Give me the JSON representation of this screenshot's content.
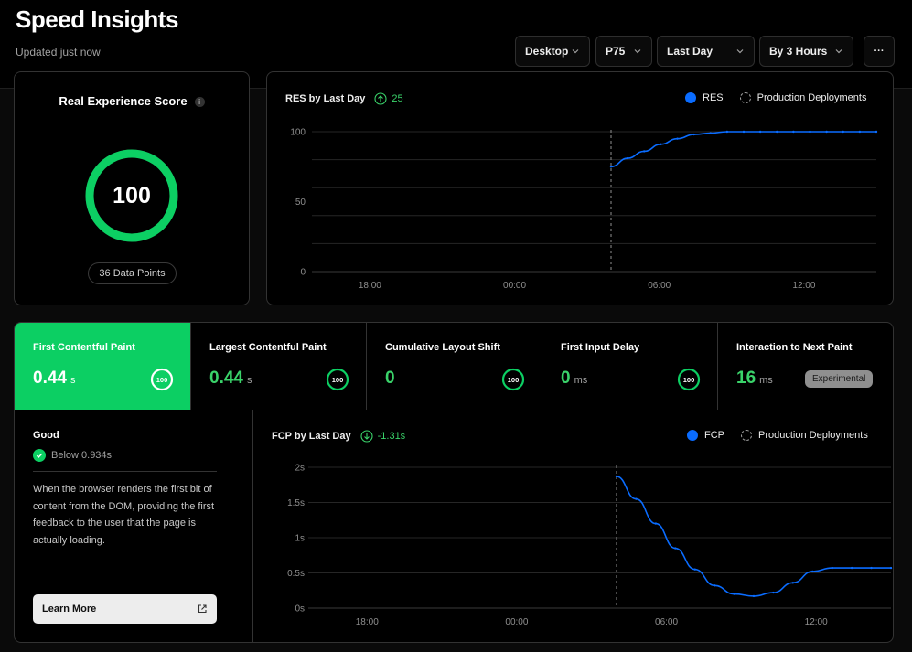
{
  "header": {
    "title": "Speed Insights",
    "subtitle": "Updated just now",
    "filters": {
      "device": "Desktop",
      "percentile": "P75",
      "range": "Last Day",
      "granularity": "By 3 Hours"
    },
    "more_label": "···"
  },
  "score_card": {
    "title": "Real Experience Score",
    "info_icon": "i",
    "value": "100",
    "score_fraction": 1.0,
    "data_points": "36 Data Points",
    "color": "#0ccf63"
  },
  "res_chart": {
    "title": "RES by Last Day",
    "delta": "25",
    "legend_series": "RES",
    "legend_deploy": "Production Deployments",
    "chart_data": {
      "type": "line",
      "title": "RES by Last Day",
      "y_ticks": [
        "100",
        "50",
        "0"
      ],
      "x_ticks": [
        "18:00",
        "00:00",
        "06:00",
        "12:00"
      ],
      "ylim": [
        0,
        100
      ],
      "series": [
        {
          "name": "RES",
          "color": "#0a6cff",
          "values": [
            75,
            81,
            86,
            91,
            95,
            98,
            99,
            100,
            100,
            100,
            100,
            100,
            100,
            100,
            100,
            100,
            100
          ]
        }
      ],
      "deployment_marker": "04:00",
      "x_start": "04:00",
      "x_end": "15:00",
      "grid": true
    }
  },
  "metrics": [
    {
      "name": "First Contentful Paint",
      "value": "0.44",
      "unit": "s",
      "score": "100",
      "active": true
    },
    {
      "name": "Largest Contentful Paint",
      "value": "0.44",
      "unit": "s",
      "score": "100",
      "active": false
    },
    {
      "name": "Cumulative Layout Shift",
      "value": "0",
      "unit": "",
      "score": "100",
      "active": false
    },
    {
      "name": "First Input Delay",
      "value": "0",
      "unit": "ms",
      "score": "100",
      "active": false
    },
    {
      "name": "Interaction to Next Paint",
      "value": "16",
      "unit": "ms",
      "badge": "Experimental",
      "active": false
    }
  ],
  "detail": {
    "rating": "Good",
    "threshold": "Below 0.934s",
    "description": "When the browser renders the first bit of content from the DOM, providing the first feedback to the user that the page is actually loading.",
    "learn_more": "Learn More"
  },
  "fcp_chart": {
    "title": "FCP by Last Day",
    "delta": "-1.31s",
    "legend_series": "FCP",
    "legend_deploy": "Production Deployments",
    "chart_data": {
      "type": "line",
      "title": "FCP by Last Day",
      "y_ticks": [
        "2s",
        "1.5s",
        "1s",
        "0.5s",
        "0s"
      ],
      "x_ticks": [
        "18:00",
        "00:00",
        "06:00",
        "12:00"
      ],
      "ylim": [
        0,
        2
      ],
      "series": [
        {
          "name": "FCP",
          "color": "#0a6cff",
          "values": [
            1.87,
            1.55,
            1.2,
            0.85,
            0.55,
            0.32,
            0.2,
            0.17,
            0.22,
            0.36,
            0.52,
            0.57,
            0.57,
            0.57,
            0.57
          ]
        }
      ],
      "deployment_marker": "04:00",
      "x_start": "04:00",
      "x_end": "15:00",
      "grid": true
    }
  }
}
